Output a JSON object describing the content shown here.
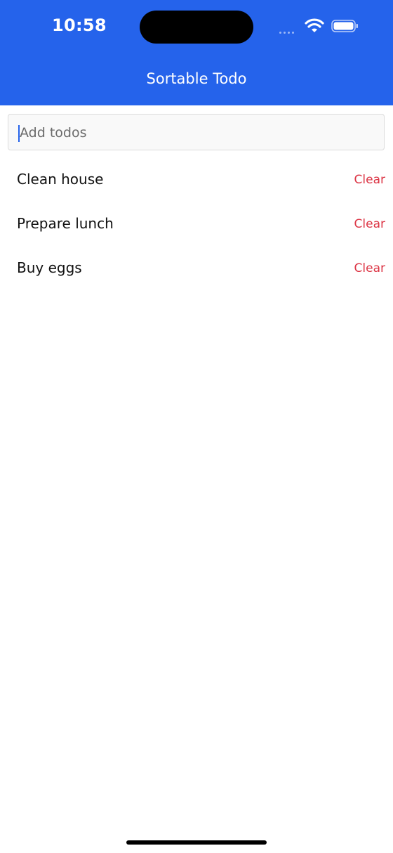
{
  "status_bar": {
    "time": "10:58",
    "icons": [
      "signal-icon",
      "wifi-icon",
      "battery-icon"
    ]
  },
  "header": {
    "title": "Sortable Todo",
    "background_color": "#2563eb"
  },
  "input": {
    "placeholder": "Add todos",
    "value": ""
  },
  "todos": [
    {
      "text": "Clean house",
      "action_label": "Clear"
    },
    {
      "text": "Prepare lunch",
      "action_label": "Clear"
    },
    {
      "text": "Buy eggs",
      "action_label": "Clear"
    }
  ],
  "colors": {
    "accent": "#2563eb",
    "clear": "#dc3545"
  }
}
